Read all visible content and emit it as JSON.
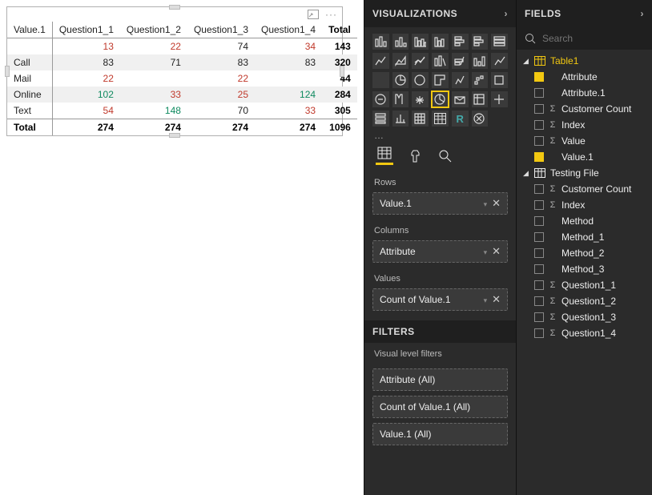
{
  "chart_data": {
    "type": "table",
    "row_header": "Value.1",
    "columns": [
      "Question1_1",
      "Question1_2",
      "Question1_3",
      "Question1_4",
      "Total"
    ],
    "rows": [
      {
        "label": "",
        "cells": [
          "13",
          "22",
          "74",
          "34",
          "143"
        ],
        "colors": [
          "#c0392b",
          "#c0392b",
          "",
          "#c0392b",
          ""
        ]
      },
      {
        "label": "Call",
        "cells": [
          "83",
          "71",
          "83",
          "83",
          "320"
        ],
        "colors": [
          "",
          "",
          "",
          "",
          ""
        ],
        "strip": true
      },
      {
        "label": "Mail",
        "cells": [
          "22",
          "",
          "22",
          "",
          "44"
        ],
        "colors": [
          "#c0392b",
          "",
          "#c0392b",
          "",
          ""
        ]
      },
      {
        "label": "Online",
        "cells": [
          "102",
          "33",
          "25",
          "124",
          "284"
        ],
        "colors": [
          "#0f8a5f",
          "#c0392b",
          "#c0392b",
          "#0f8a5f",
          ""
        ],
        "strip": true
      },
      {
        "label": "Text",
        "cells": [
          "54",
          "148",
          "70",
          "33",
          "305"
        ],
        "colors": [
          "#c0392b",
          "#0f8a5f",
          "",
          "#c0392b",
          ""
        ]
      }
    ],
    "totals": {
      "label": "Total",
      "cells": [
        "274",
        "274",
        "274",
        "274",
        "1096"
      ]
    }
  },
  "viz": {
    "header": "VISUALIZATIONS",
    "wells": {
      "rows": {
        "label": "Rows",
        "pill": "Value.1"
      },
      "cols": {
        "label": "Columns",
        "pill": "Attribute"
      },
      "vals": {
        "label": "Values",
        "pill": "Count of Value.1"
      }
    },
    "filtersHeader": "FILTERS",
    "filtersLabel": "Visual level filters",
    "filters": [
      "Attribute  (All)",
      "Count of Value.1  (All)",
      "Value.1  (All)"
    ]
  },
  "fields": {
    "header": "FIELDS",
    "searchPlaceholder": "Search",
    "tables": [
      {
        "name": "Table1",
        "highlight": true,
        "fields": [
          {
            "name": "Attribute",
            "checked": true,
            "sigma": false
          },
          {
            "name": "Attribute.1",
            "checked": false,
            "sigma": false
          },
          {
            "name": "Customer Count",
            "checked": false,
            "sigma": true
          },
          {
            "name": "Index",
            "checked": false,
            "sigma": true
          },
          {
            "name": "Value",
            "checked": false,
            "sigma": true
          },
          {
            "name": "Value.1",
            "checked": true,
            "sigma": false
          }
        ]
      },
      {
        "name": "Testing File",
        "highlight": false,
        "fields": [
          {
            "name": "Customer Count",
            "checked": false,
            "sigma": true
          },
          {
            "name": "Index",
            "checked": false,
            "sigma": true
          },
          {
            "name": "Method",
            "checked": false,
            "sigma": false
          },
          {
            "name": "Method_1",
            "checked": false,
            "sigma": false
          },
          {
            "name": "Method_2",
            "checked": false,
            "sigma": false
          },
          {
            "name": "Method_3",
            "checked": false,
            "sigma": false
          },
          {
            "name": "Question1_1",
            "checked": false,
            "sigma": true
          },
          {
            "name": "Question1_2",
            "checked": false,
            "sigma": true
          },
          {
            "name": "Question1_3",
            "checked": false,
            "sigma": true
          },
          {
            "name": "Question1_4",
            "checked": false,
            "sigma": true
          }
        ]
      }
    ]
  }
}
